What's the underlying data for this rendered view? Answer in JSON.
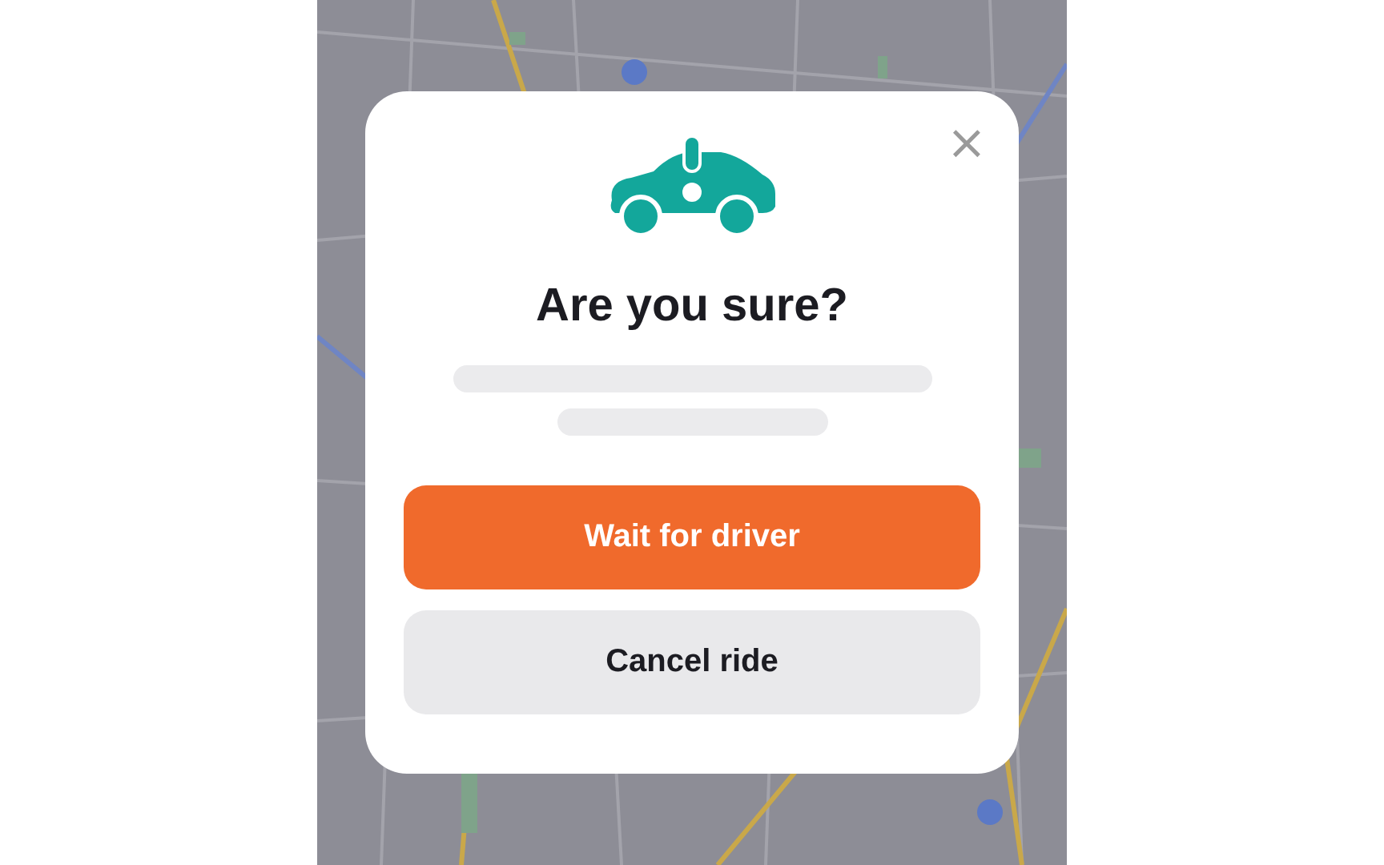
{
  "dialog": {
    "title": "Are you sure?",
    "close": "×",
    "buttons": [
      {
        "label": "Wait for driver",
        "kind": "primary"
      },
      {
        "label": "Cancel ride",
        "kind": "secondary"
      }
    ]
  }
}
